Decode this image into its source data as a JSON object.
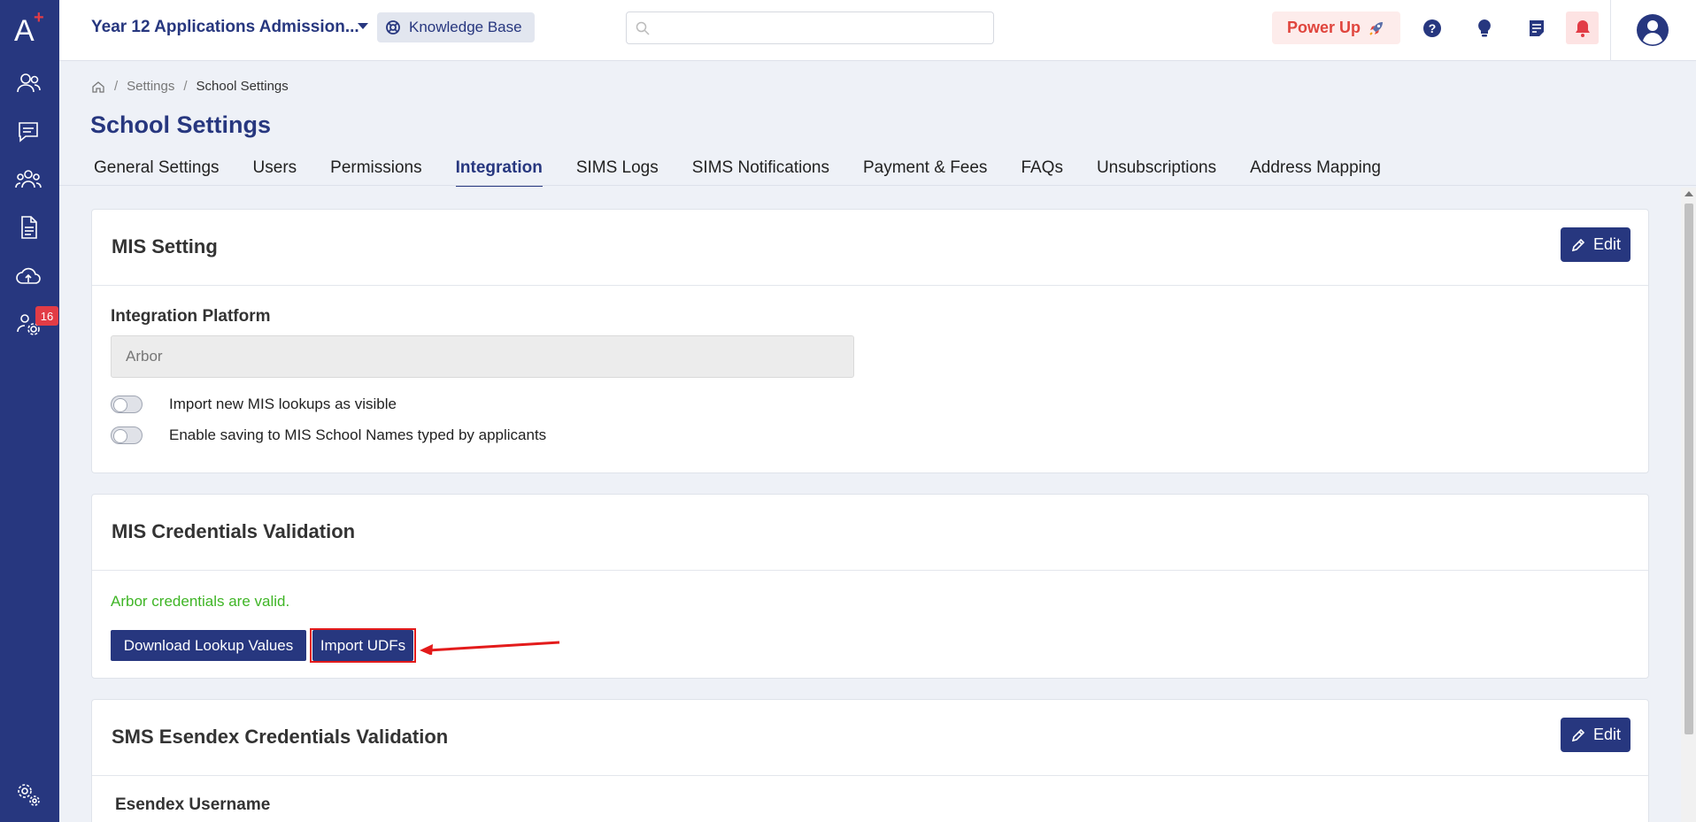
{
  "brand": {
    "logo_text": "A",
    "logo_plus": "+"
  },
  "sidebar": {
    "items": [
      {
        "icon": "users-icon"
      },
      {
        "icon": "chat-icon"
      },
      {
        "icon": "group-icon"
      },
      {
        "icon": "document-icon"
      },
      {
        "icon": "cloud-upload-icon"
      },
      {
        "icon": "user-settings-icon",
        "badge": "16"
      },
      {
        "icon": "settings-icon"
      }
    ]
  },
  "header": {
    "app_title": "Year 12 Applications Admission...",
    "knowledge_base": "Knowledge Base",
    "search_placeholder": "",
    "power_up": "Power Up"
  },
  "breadcrumb": {
    "settings": "Settings",
    "current": "School Settings"
  },
  "page_title": "School Settings",
  "tabs": [
    {
      "label": "General Settings"
    },
    {
      "label": "Users"
    },
    {
      "label": "Permissions"
    },
    {
      "label": "Integration",
      "active": true
    },
    {
      "label": "SIMS Logs"
    },
    {
      "label": "SIMS Notifications"
    },
    {
      "label": "Payment & Fees"
    },
    {
      "label": "FAQs"
    },
    {
      "label": "Unsubscriptions"
    },
    {
      "label": "Address Mapping"
    }
  ],
  "mis_setting": {
    "title": "MIS Setting",
    "edit_label": "Edit",
    "platform_label": "Integration Platform",
    "platform_value": "Arbor",
    "toggle_1": "Import new MIS lookups as visible",
    "toggle_2": "Enable saving to MIS School Names typed by applicants"
  },
  "mis_credentials": {
    "title": "MIS Credentials Validation",
    "status": "Arbor credentials are valid.",
    "download_btn": "Download Lookup Values",
    "import_btn": "Import UDFs"
  },
  "sms_credentials": {
    "title": "SMS Esendex Credentials Validation",
    "edit_label": "Edit",
    "username_label": "Esendex Username"
  },
  "colors": {
    "primary": "#27377f",
    "valid": "#3fb526",
    "highlight": "#e31b1b",
    "power_up": "#e0453d"
  }
}
